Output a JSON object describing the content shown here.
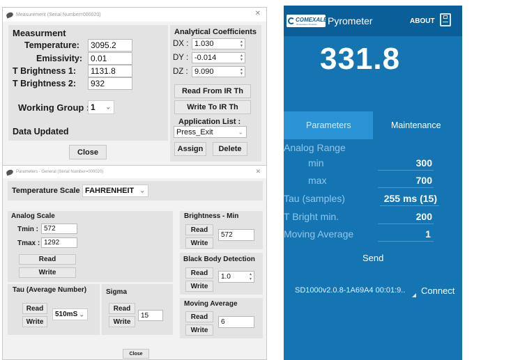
{
  "measurement_window": {
    "title": "Measurement (Serial Number=000020)",
    "heading": "Measurment",
    "rows": [
      {
        "label": "Temperature:",
        "value": "3095.2"
      },
      {
        "label": "Emissivity:",
        "value": "0.01"
      },
      {
        "label": "T Brightness 1:",
        "value": "1131.8"
      },
      {
        "label": "T Brightness 2:",
        "value": "932"
      }
    ],
    "working_group_label": "Working Group :",
    "working_group_value": "1",
    "status": "Data Updated",
    "close_label": "Close",
    "coefficients": {
      "heading": "Analytical Coefficients",
      "dx_label": "DX :",
      "dx_value": "1.030",
      "dy_label": "DY :",
      "dy_value": "-0.014",
      "dz_label": "DZ :",
      "dz_value": "9.090"
    },
    "read_label": "Read From IR Th",
    "write_label": "Write To IR Th",
    "app_list_label": "Application List :",
    "app_list_value": "Press_Exit",
    "assign_label": "Assign",
    "delete_label": "Delete"
  },
  "parameters_window": {
    "title": "Parameters - General (Serial Number=000020)",
    "scale_label": "Temperature Scale :",
    "scale_value": "FAHRENHEIT",
    "analog": {
      "heading": "Analog Scale",
      "tmin_label": "Tmin :",
      "tmin_value": "572",
      "tmax_label": "Tmax :",
      "tmax_value": "1292",
      "read_label": "Read",
      "write_label": "Write"
    },
    "tau": {
      "heading": "Tau (Average Number)",
      "read_label": "Read",
      "write_label": "Write",
      "value": "510mS"
    },
    "sigma": {
      "heading": "Sigma",
      "read_label": "Read",
      "write_label": "Write",
      "value": "15"
    },
    "brightness": {
      "heading": "Brightness - Min",
      "read_label": "Read",
      "write_label": "Write",
      "value": "572"
    },
    "blackbody": {
      "heading": "Black Body Detection",
      "read_label": "Read",
      "write_label": "Write",
      "value": "1.0"
    },
    "moving": {
      "heading": "Moving Average",
      "read_label": "Read",
      "write_label": "Write",
      "value": "6"
    },
    "close_label": "Close"
  },
  "phone": {
    "brand": "COMEXALE",
    "brand_sub": "Temperature Products",
    "app_title": "Pyrometer",
    "about_label": "ABOUT",
    "reading": "331.8",
    "tabs": [
      "Parameters",
      "Maintenance"
    ],
    "rows": [
      {
        "label": "Analog Range",
        "value": ""
      },
      {
        "label": "min",
        "value": "300"
      },
      {
        "label": "max",
        "value": "700"
      },
      {
        "label": "Tau (samples)",
        "value": "255 ms (15)"
      },
      {
        "label": "T Bright min.",
        "value": "200"
      },
      {
        "label": "Moving Average",
        "value": "1"
      }
    ],
    "send_label": "Send",
    "device": "SD1000v2.0.8-1A69A4 00:01:9..",
    "connect_label": "Connect",
    "colors": {
      "bar": "#0b5f99",
      "body": "#1575b3",
      "active_tab": "#2a93d6",
      "muted_label": "#8fc7ec"
    }
  }
}
